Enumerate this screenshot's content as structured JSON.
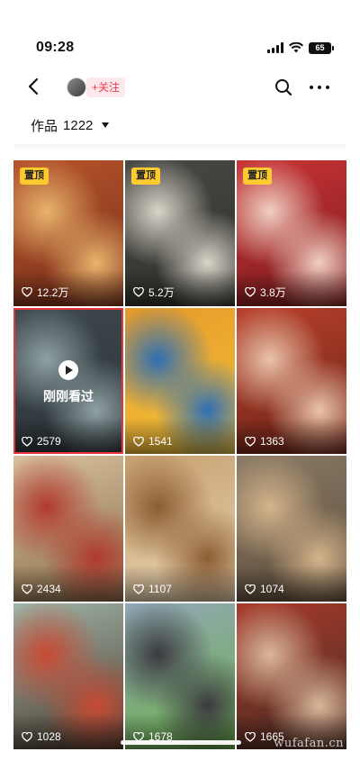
{
  "status_bar": {
    "time": "09:28",
    "battery": "65"
  },
  "header": {
    "follow_label": "+关注"
  },
  "works": {
    "label": "作品",
    "count": "1222"
  },
  "grid": [
    {
      "pinned": true,
      "likes": "12.2万",
      "bg": [
        "#b6542b",
        "#e7b36c",
        "#7a2f1a"
      ]
    },
    {
      "pinned": true,
      "likes": "5.2万",
      "bg": [
        "#4a4a45",
        "#d8d4c9",
        "#2e2e2a"
      ]
    },
    {
      "pinned": true,
      "likes": "3.8万",
      "bg": [
        "#c93335",
        "#f0cfc2",
        "#7c1c1e"
      ]
    },
    {
      "pinned": false,
      "watched": true,
      "watched_label": "刚刚看过",
      "likes": "2579",
      "bg": [
        "#3f4a4f",
        "#8fa0a3",
        "#2a3236"
      ]
    },
    {
      "pinned": false,
      "likes": "1541",
      "bg": [
        "#e79a2a",
        "#2e6fb3",
        "#f2c23a"
      ]
    },
    {
      "pinned": false,
      "likes": "1363",
      "bg": [
        "#b8402c",
        "#e9c3a8",
        "#6d2417"
      ]
    },
    {
      "pinned": false,
      "likes": "2434",
      "bg": [
        "#d9c2a0",
        "#b13a2f",
        "#8a6e4a"
      ]
    },
    {
      "pinned": false,
      "likes": "1107",
      "bg": [
        "#c7a070",
        "#8c5d33",
        "#e8d4b2"
      ]
    },
    {
      "pinned": false,
      "likes": "1074",
      "bg": [
        "#8a7a66",
        "#d4b48a",
        "#5e4d3b"
      ]
    },
    {
      "pinned": false,
      "likes": "1028",
      "bg": [
        "#9fb6a8",
        "#c74a34",
        "#4d3a2e"
      ]
    },
    {
      "pinned": false,
      "likes": "1678",
      "bg": [
        "#93a7b8",
        "#3b3a40",
        "#6bb04a"
      ]
    },
    {
      "pinned": false,
      "likes": "1665",
      "bg": [
        "#a63a2b",
        "#d8b79a",
        "#4a2c22"
      ]
    }
  ],
  "pin_label": "置顶",
  "watermark": "wufafan.cn"
}
